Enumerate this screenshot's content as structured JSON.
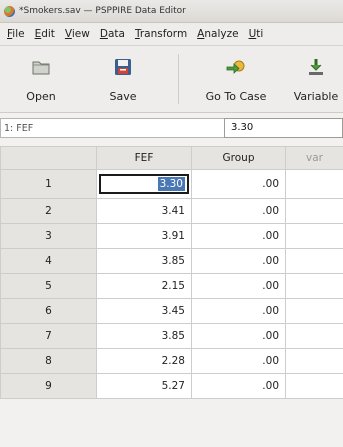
{
  "window": {
    "title": "*Smokers.sav — PSPPIRE Data Editor"
  },
  "menu": [
    {
      "mn": "F",
      "rest": "ile"
    },
    {
      "mn": "E",
      "rest": "dit"
    },
    {
      "mn": "V",
      "rest": "iew"
    },
    {
      "mn": "D",
      "rest": "ata"
    },
    {
      "mn": "T",
      "rest": "ransform"
    },
    {
      "mn": "A",
      "rest": "nalyze"
    },
    {
      "mn": "U",
      "rest": "ti"
    }
  ],
  "toolbar": {
    "open": "Open",
    "save": "Save",
    "goto": "Go To Case",
    "variable": "Variable"
  },
  "refline": {
    "cell_ref": "1: FEF",
    "cell_value": "3.30"
  },
  "grid": {
    "columns": [
      "FEF",
      "Group",
      "var"
    ],
    "rows": [
      {
        "n": "1",
        "fef": "3.30",
        "group": ".00"
      },
      {
        "n": "2",
        "fef": "3.41",
        "group": ".00"
      },
      {
        "n": "3",
        "fef": "3.91",
        "group": ".00"
      },
      {
        "n": "4",
        "fef": "3.85",
        "group": ".00"
      },
      {
        "n": "5",
        "fef": "2.15",
        "group": ".00"
      },
      {
        "n": "6",
        "fef": "3.45",
        "group": ".00"
      },
      {
        "n": "7",
        "fef": "3.85",
        "group": ".00"
      },
      {
        "n": "8",
        "fef": "2.28",
        "group": ".00"
      },
      {
        "n": "9",
        "fef": "5.27",
        "group": ".00"
      }
    ]
  },
  "colors": {
    "selection": "#4a78b5",
    "header_bg": "#e6e4e1"
  }
}
